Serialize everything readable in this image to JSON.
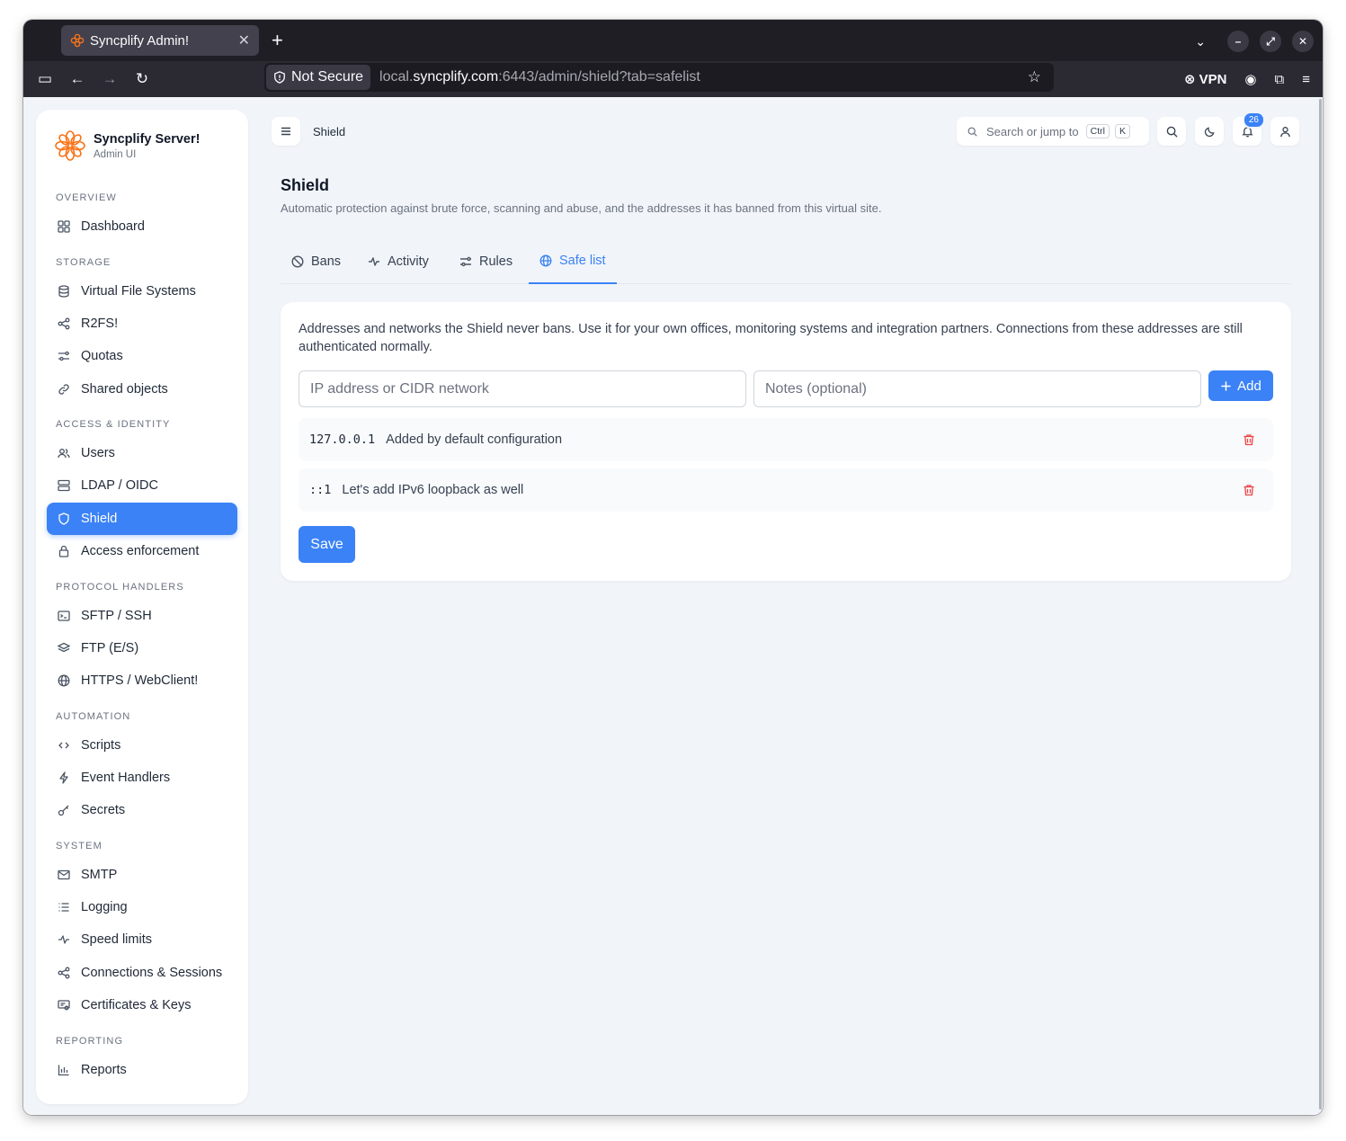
{
  "browser": {
    "tab_title": "Syncplify Admin!",
    "not_secure_label": "Not Secure",
    "url_prefix": "local.",
    "url_domain": "syncplify.com",
    "url_suffix": ":6443/admin/shield?tab=safelist",
    "vpn_label": "VPN"
  },
  "brand": {
    "name": "Syncplify Server!",
    "subtitle": "Admin UI",
    "accent": "#f97316"
  },
  "sidebar": {
    "sections": {
      "overview": "OVERVIEW",
      "storage": "STORAGE",
      "access": "ACCESS & IDENTITY",
      "protocol": "PROTOCOL HANDLERS",
      "automation": "AUTOMATION",
      "system": "SYSTEM",
      "reporting": "REPORTING"
    },
    "items": {
      "dashboard": "Dashboard",
      "vfs": "Virtual File Systems",
      "r2fs": "R2FS!",
      "quotas": "Quotas",
      "shared": "Shared objects",
      "users": "Users",
      "ldap": "LDAP / OIDC",
      "shield": "Shield",
      "access_enforcement": "Access enforcement",
      "sftp": "SFTP / SSH",
      "ftp": "FTP (E/S)",
      "https": "HTTPS / WebClient!",
      "scripts": "Scripts",
      "event_handlers": "Event Handlers",
      "secrets": "Secrets",
      "smtp": "SMTP",
      "logging": "Logging",
      "speed": "Speed limits",
      "connections": "Connections & Sessions",
      "certs": "Certificates & Keys",
      "reports": "Reports"
    }
  },
  "header": {
    "breadcrumb": "Shield",
    "search_placeholder": "Search or jump to",
    "kbd_ctrl": "Ctrl",
    "kbd_k": "K",
    "notification_count": "26"
  },
  "page": {
    "title": "Shield",
    "description": "Automatic protection against brute force, scanning and abuse, and the addresses it has banned from this virtual site.",
    "tabs": {
      "bans": "Bans",
      "activity": "Activity",
      "rules": "Rules",
      "safelist": "Safe list"
    }
  },
  "safelist": {
    "description": "Addresses and networks the Shield never bans. Use it for your own offices, monitoring systems and integration partners. Connections from these addresses are still authenticated normally.",
    "ip_placeholder": "IP address or CIDR network",
    "notes_placeholder": "Notes (optional)",
    "add_label": "Add",
    "entries": [
      {
        "address": "127.0.0.1",
        "note": "Added by default configuration"
      },
      {
        "address": "::1",
        "note": "Let's add IPv6 loopback as well"
      }
    ],
    "save_label": "Save"
  },
  "colors": {
    "primary": "#3b82f6",
    "danger": "#ef4444",
    "background": "#f1f5f9"
  }
}
